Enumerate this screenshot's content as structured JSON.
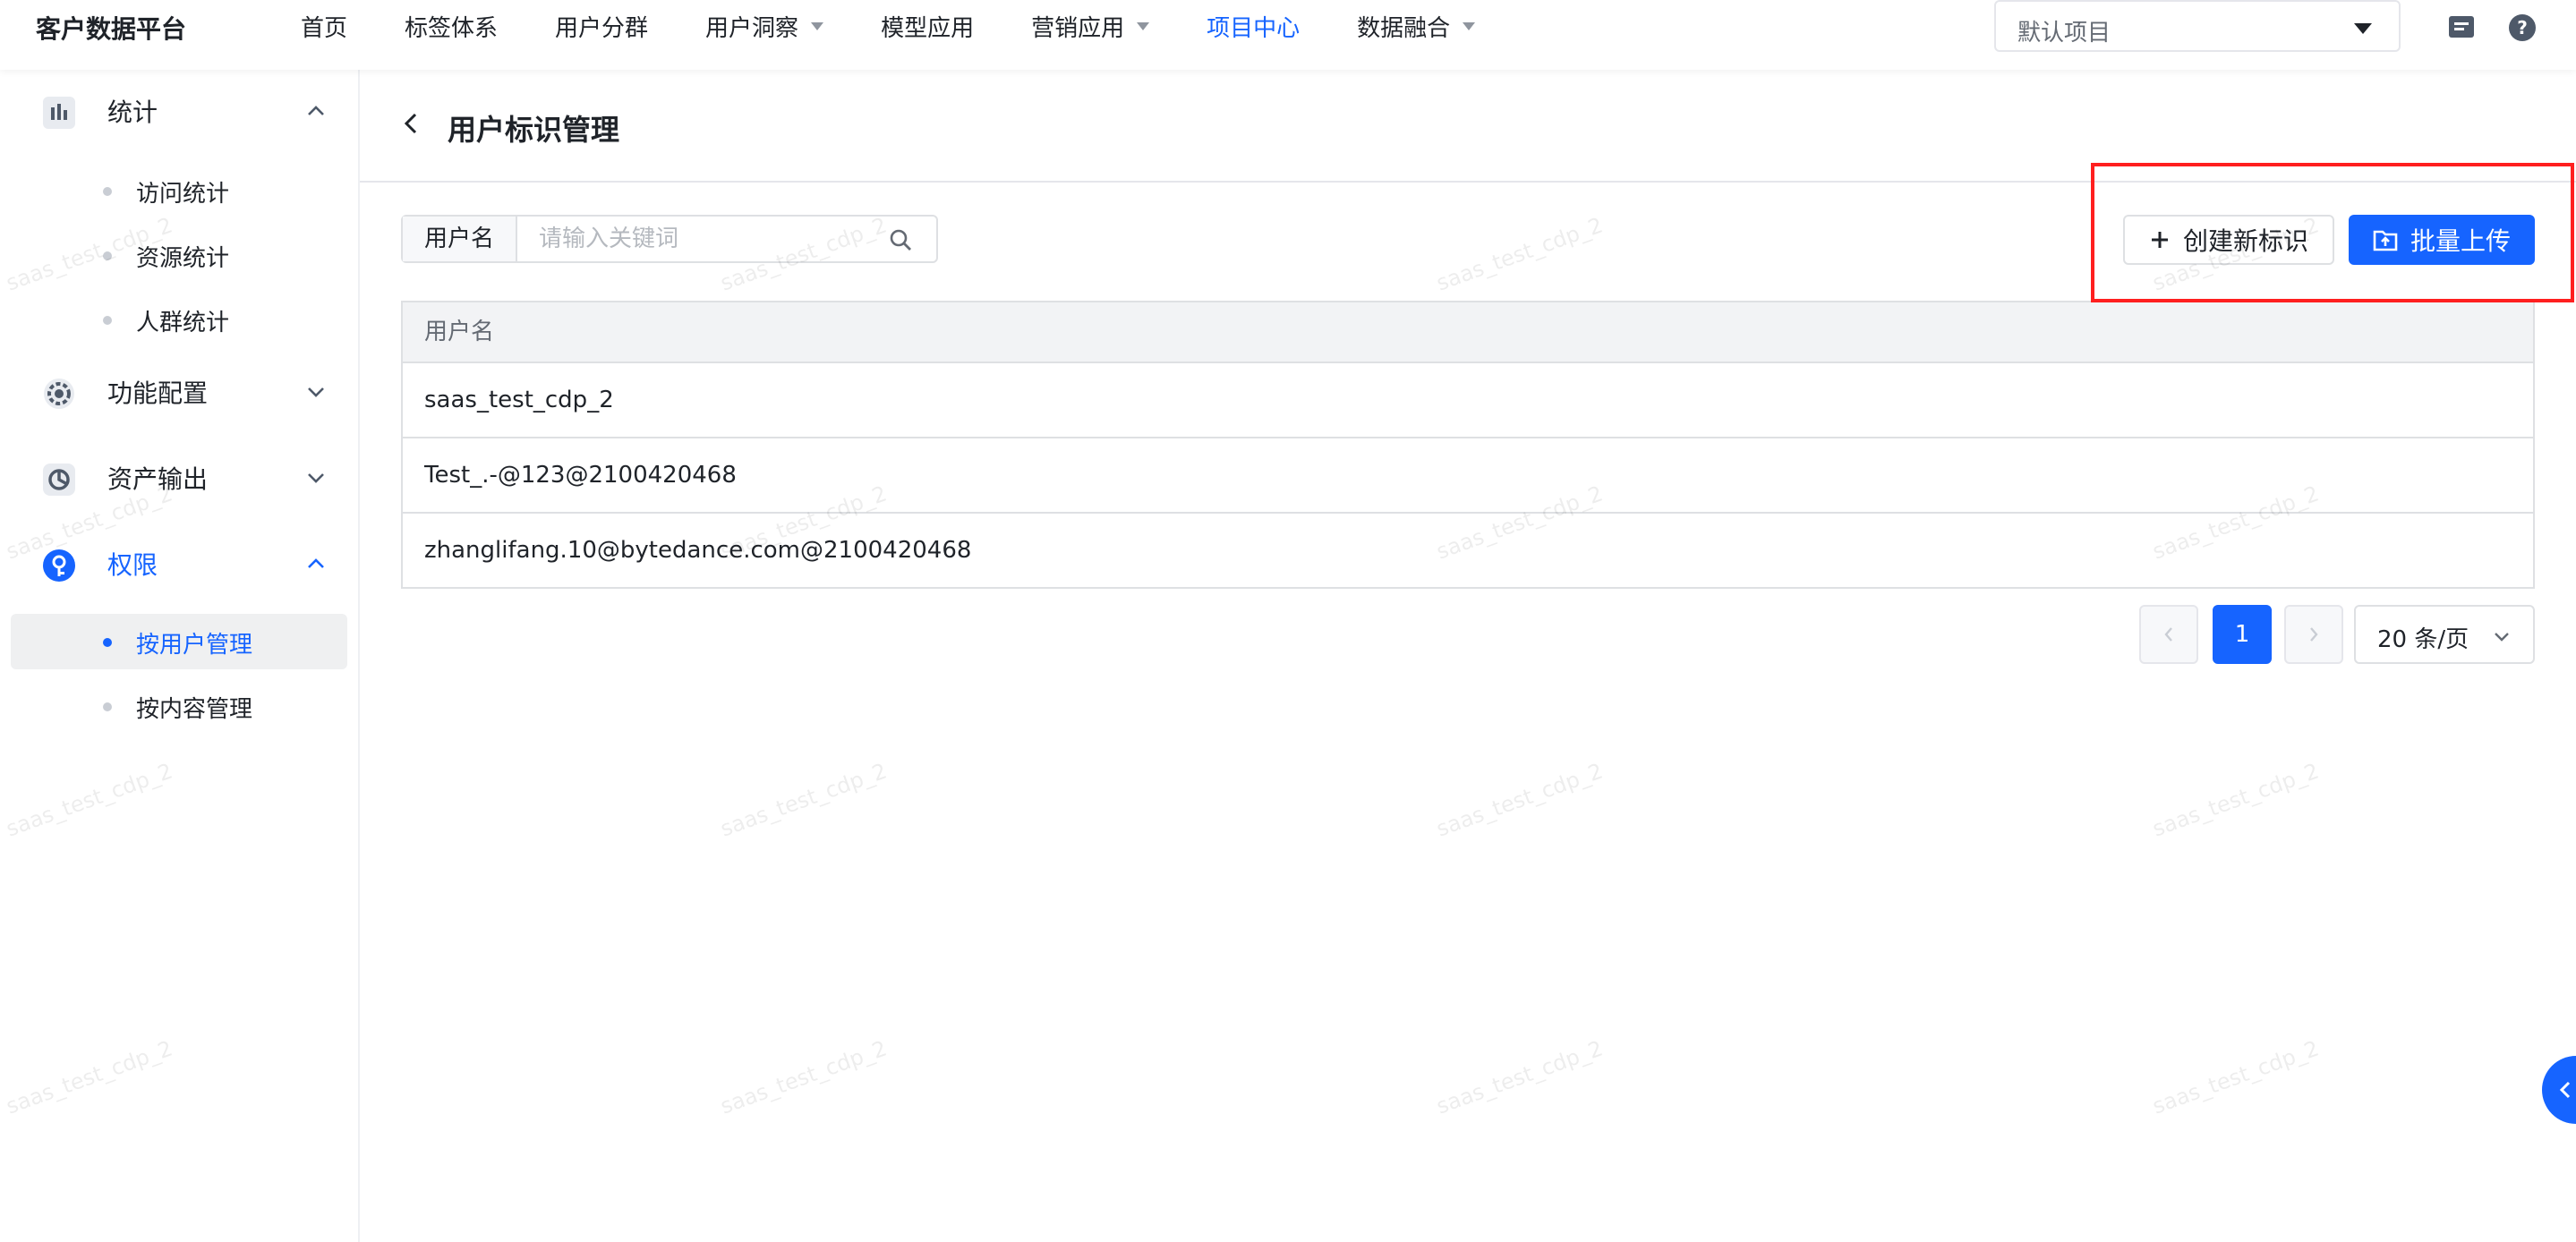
{
  "app": {
    "title": "客户数据平台"
  },
  "nav": {
    "items": [
      {
        "label": "首页",
        "dropdown": false,
        "active": false
      },
      {
        "label": "标签体系",
        "dropdown": false,
        "active": false
      },
      {
        "label": "用户分群",
        "dropdown": false,
        "active": false
      },
      {
        "label": "用户洞察",
        "dropdown": true,
        "active": false
      },
      {
        "label": "模型应用",
        "dropdown": false,
        "active": false
      },
      {
        "label": "营销应用",
        "dropdown": true,
        "active": false
      },
      {
        "label": "项目中心",
        "dropdown": false,
        "active": true
      },
      {
        "label": "数据融合",
        "dropdown": true,
        "active": false
      }
    ],
    "project_select": "默认项目"
  },
  "sidebar": {
    "groups": [
      {
        "label": "统计",
        "icon": "bar-chart-icon",
        "expanded": true,
        "children": [
          "访问统计",
          "资源统计",
          "人群统计"
        ]
      },
      {
        "label": "功能配置",
        "icon": "gear-icon",
        "expanded": false
      },
      {
        "label": "资产输出",
        "icon": "export-icon",
        "expanded": false
      },
      {
        "label": "权限",
        "icon": "key-icon",
        "expanded": true,
        "active": true,
        "children": [
          "按用户管理",
          "按内容管理"
        ]
      }
    ],
    "selected_item": "按用户管理"
  },
  "page": {
    "title": "用户标识管理",
    "search": {
      "prefix": "用户名",
      "placeholder": "请输入关键词",
      "value": ""
    },
    "actions": {
      "create": "创建新标识",
      "upload": "批量上传"
    },
    "table": {
      "header": "用户名",
      "rows": [
        "saas_test_cdp_2",
        "Test_.-@123@2100420468",
        "zhanglifang.10@bytedance.com@2100420468"
      ]
    },
    "pagination": {
      "current_page": "1",
      "page_size": "20 条/页"
    }
  },
  "watermark": "saas_test_cdp_2",
  "colors": {
    "accent": "#1664ff",
    "highlight_box": "#ff1f1f"
  }
}
